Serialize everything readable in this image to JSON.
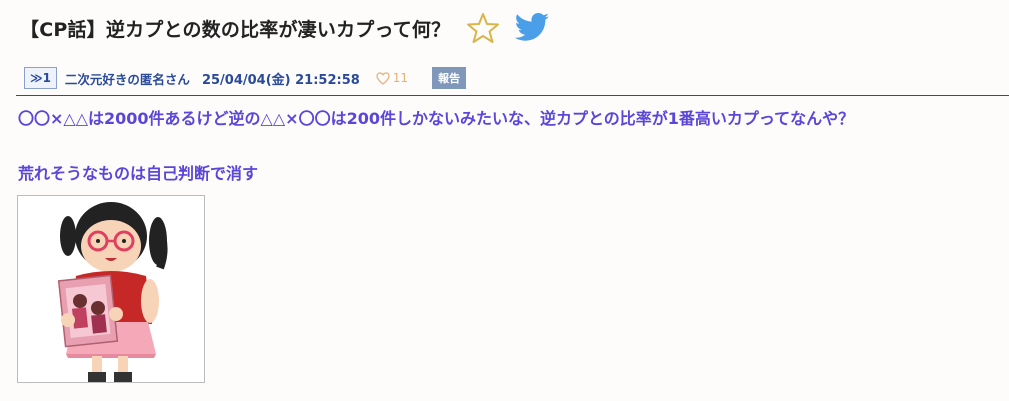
{
  "thread": {
    "title": "【CP話】逆カプとの数の比率が凄いカプって何？"
  },
  "post": {
    "number_label": "≫1",
    "author": "二次元好きの匿名さん",
    "date": "25/04/04(金) 21:52:58",
    "likes": "11",
    "report_label": "報告",
    "body_line1": "〇〇×△△は2000件あるけど逆の△△×〇〇は200件しかないみたいな、逆カプとの比率が1番高いカプってなんや？",
    "body_line2": "荒れそうなものは自己判断で消す"
  },
  "icons": {
    "favorite": "star-outline-icon",
    "share": "twitter-bird-icon",
    "like": "heart-outline-icon"
  },
  "colors": {
    "link": "#2a4a9a",
    "body_text": "#5a46d8",
    "star": "#d9b44a",
    "twitter": "#4a9fe8",
    "heart": "#e8b07a",
    "report_bg": "#7f97ba"
  }
}
